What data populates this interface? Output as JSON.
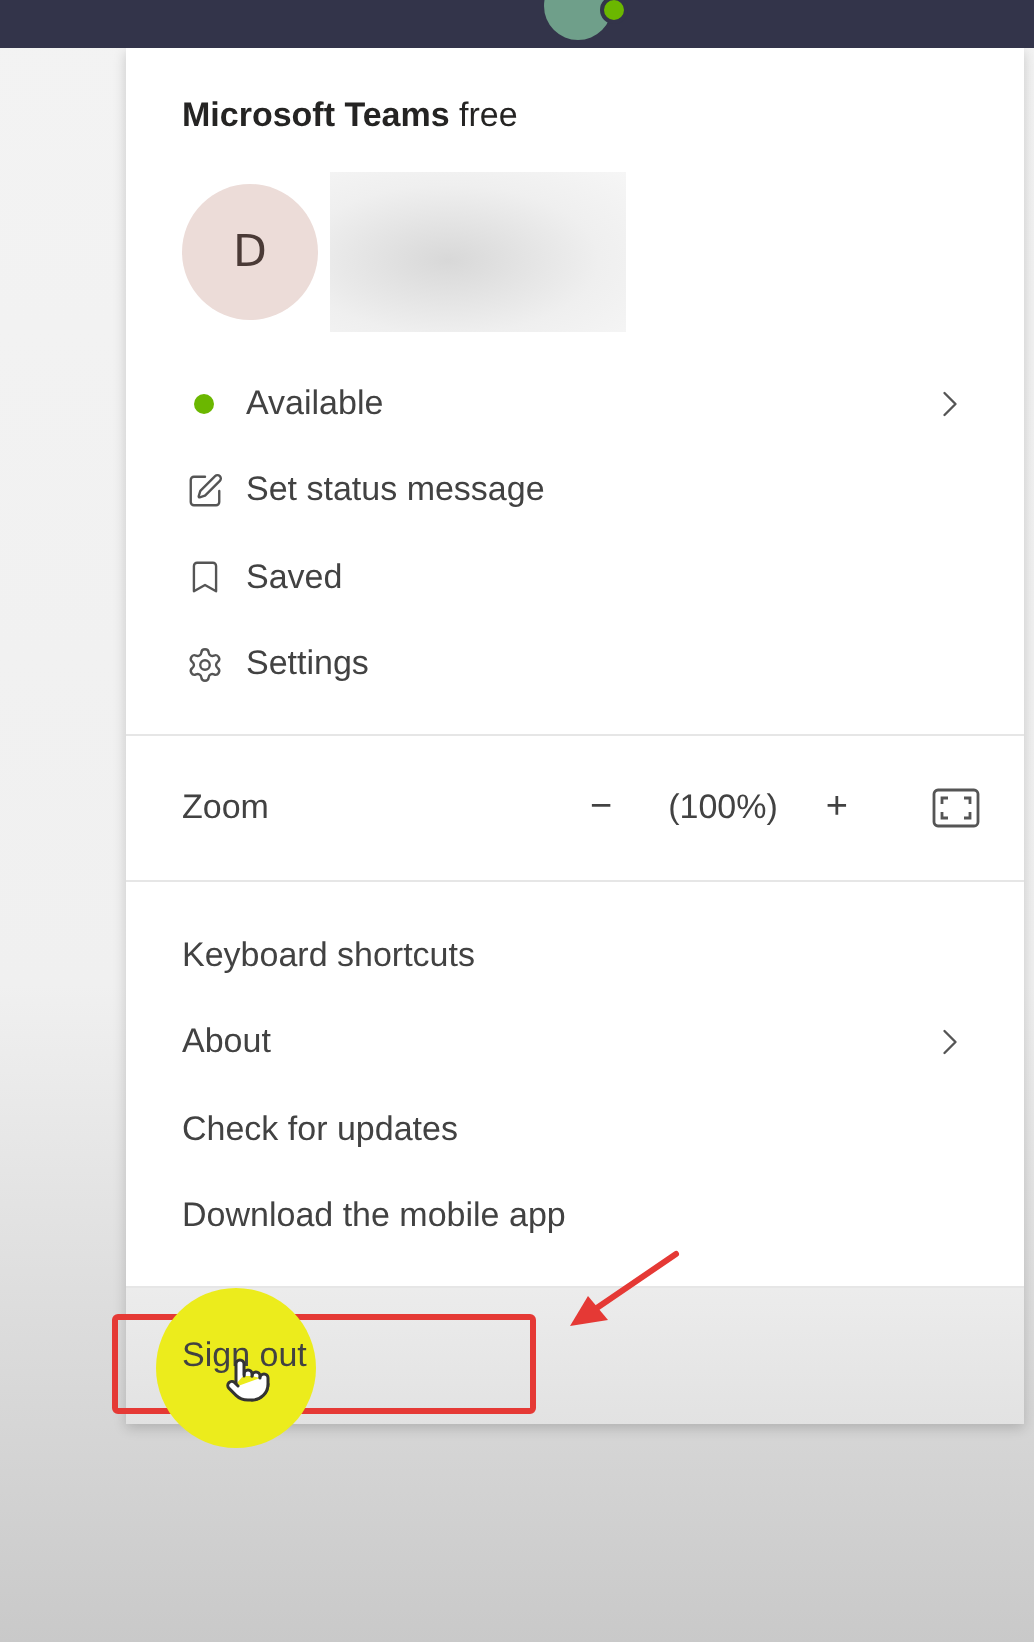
{
  "menu": {
    "title": "**Microsoft Teams** free",
    "avatar_initial": "D",
    "name_redacted": true,
    "sections": [
      {
        "kind": "list",
        "items": [
          {
            "kind": "status",
            "label": "Available",
            "color": "#6bb700",
            "submenu": true
          },
          {
            "kind": "edit",
            "label": "Set status message",
            "submenu": false
          },
          {
            "kind": "bookmark",
            "label": "Saved",
            "submenu": false
          },
          {
            "kind": "settings",
            "label": "Settings",
            "submenu": false
          }
        ]
      },
      {
        "kind": "zoom",
        "label": "Zoom",
        "minus": "−",
        "value": "(100%)",
        "plus": "+"
      },
      {
        "kind": "list",
        "items": [
          {
            "kind": "plain",
            "label": "Keyboard shortcuts",
            "submenu": false
          },
          {
            "kind": "plain",
            "label": "About",
            "submenu": true
          },
          {
            "kind": "plain",
            "label": "Check for updates",
            "submenu": false
          },
          {
            "kind": "plain",
            "label": "Download the mobile app",
            "submenu": false
          }
        ]
      },
      {
        "kind": "signout",
        "label": "Sign out",
        "hovered": true,
        "highlighted": true
      }
    ]
  }
}
